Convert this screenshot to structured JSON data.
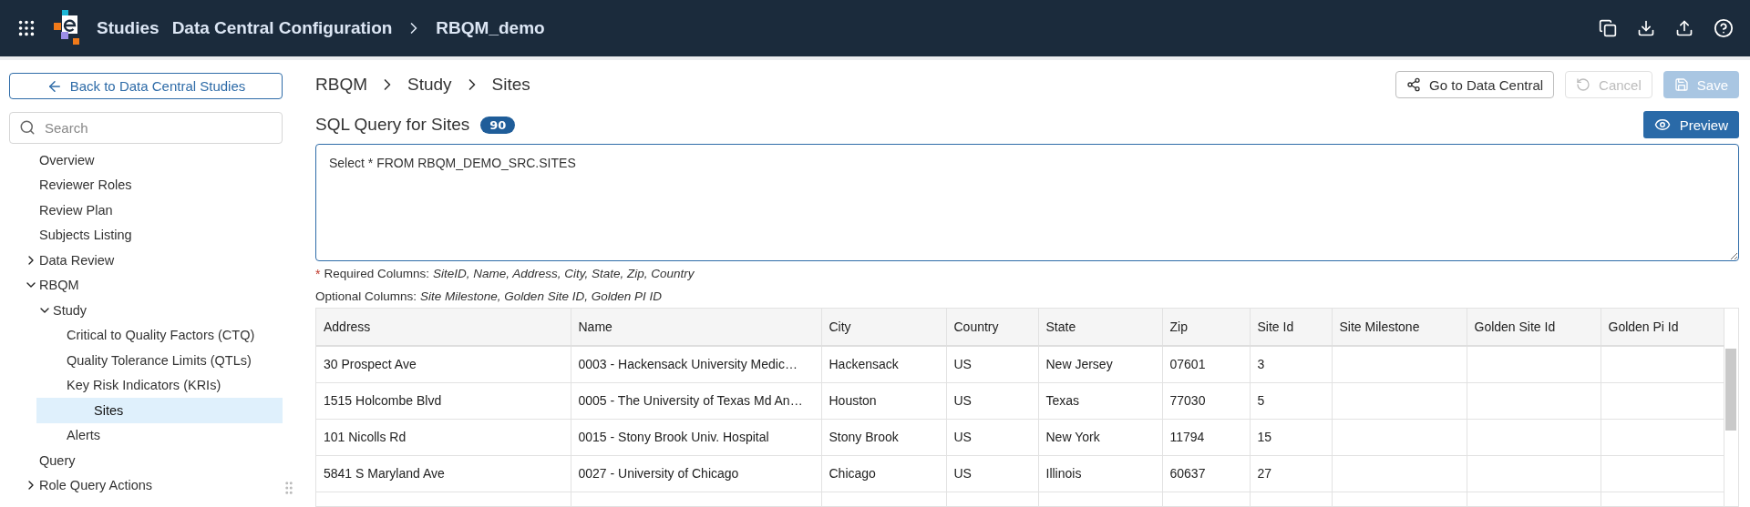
{
  "header": {
    "nav": [
      {
        "label": "Studies"
      },
      {
        "label": "Data Central Configuration"
      },
      {
        "label": "RBQM_demo"
      }
    ]
  },
  "sidebar": {
    "back_button": "Back to Data Central Studies",
    "search": {
      "placeholder": "Search"
    },
    "items": [
      {
        "label": "Overview",
        "selected": false
      },
      {
        "label": "Reviewer Roles",
        "selected": false
      },
      {
        "label": "Review Plan",
        "selected": false
      },
      {
        "label": "Subjects Listing",
        "selected": false
      },
      {
        "label": "Data Review",
        "selected": false,
        "expanded": false
      },
      {
        "label": "RBQM",
        "selected": false,
        "expanded": true,
        "children": [
          {
            "label": "Study",
            "selected": false,
            "expanded": true,
            "children": [
              {
                "label": "Critical to Quality Factors (CTQ)",
                "selected": false
              },
              {
                "label": "Quality Tolerance Limits (QTLs)",
                "selected": false
              },
              {
                "label": "Key Risk Indicators (KRIs)",
                "selected": false
              },
              {
                "label": "Sites",
                "selected": true
              },
              {
                "label": "Alerts",
                "selected": false
              }
            ]
          }
        ]
      },
      {
        "label": "Query",
        "selected": false
      },
      {
        "label": "Role Query Actions",
        "selected": false,
        "expanded": false
      }
    ]
  },
  "breadcrumb": [
    {
      "label": "RBQM"
    },
    {
      "label": "Study"
    },
    {
      "label": "Sites"
    }
  ],
  "actions": [
    {
      "kind": "link",
      "label": "Go to Data Central",
      "disabled": false
    },
    {
      "kind": "cancel",
      "label": "Cancel",
      "disabled": true
    },
    {
      "kind": "save",
      "label": "Save",
      "disabled": true
    }
  ],
  "query": {
    "title": "SQL Query for Sites",
    "count": "90",
    "preview_button": "Preview",
    "value": "Select * FROM RBQM_DEMO_SRC.SITES",
    "required_mark": "*",
    "required_label": "Required Columns:",
    "required_columns": "SiteID, Name, Address, City, State, Zip, Country",
    "optional_label": "Optional Columns:",
    "optional_columns": "Site Milestone, Golden Site ID, Golden PI ID"
  },
  "table": {
    "columns": [
      "Address",
      "Name",
      "City",
      "Country",
      "State",
      "Zip",
      "Site Id",
      "Site Milestone",
      "Golden Site Id",
      "Golden Pi Id"
    ],
    "rows": [
      [
        "30 Prospect Ave",
        "0003 - Hackensack University Medic…",
        "Hackensack",
        "US",
        "New Jersey",
        "07601",
        "3",
        "",
        "",
        ""
      ],
      [
        "1515 Holcombe Blvd",
        "0005 - The University of Texas Md An…",
        "Houston",
        "US",
        "Texas",
        "77030",
        "5",
        "",
        "",
        ""
      ],
      [
        "101 Nicolls Rd",
        "0015 - Stony Brook Univ. Hospital",
        "Stony Brook",
        "US",
        "New York",
        "11794",
        "15",
        "",
        "",
        ""
      ],
      [
        "5841 S Maryland Ave",
        "0027 - University of Chicago",
        "Chicago",
        "US",
        "Illinois",
        "60637",
        "27",
        "",
        "",
        ""
      ]
    ]
  }
}
